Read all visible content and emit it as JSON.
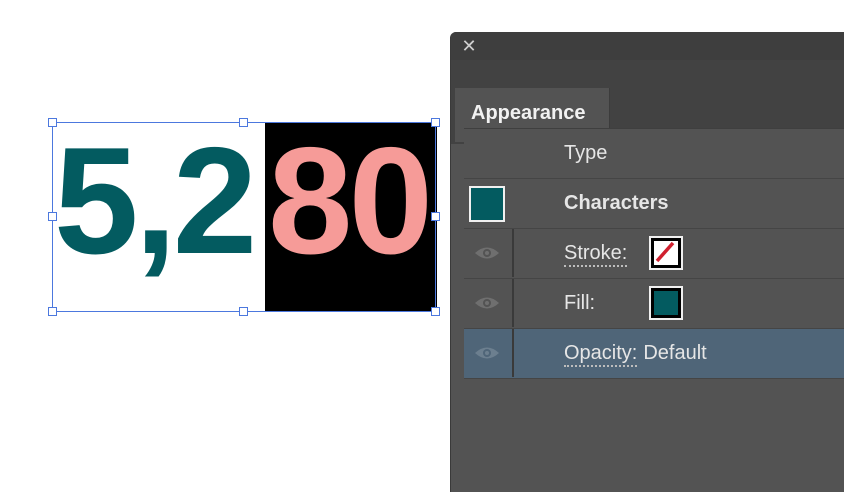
{
  "canvas": {
    "text_dark": "5,2",
    "text_highlight": "80",
    "dark_color": "#035b60",
    "highlight_color": "#f69b98",
    "highlight_bg": "#000000",
    "selection_color": "#4c78de"
  },
  "panel": {
    "close_icon": "✕",
    "tab_label": "Appearance",
    "rows": {
      "type": {
        "label": "Type"
      },
      "characters": {
        "label": "Characters",
        "thumb_color": "#035b60"
      },
      "stroke": {
        "label": "Stroke:",
        "swatch": "none-red-slash"
      },
      "fill": {
        "label": "Fill:",
        "swatch_color": "#035b60"
      },
      "opacity": {
        "label": "Opacity:",
        "value": "Default"
      }
    }
  }
}
